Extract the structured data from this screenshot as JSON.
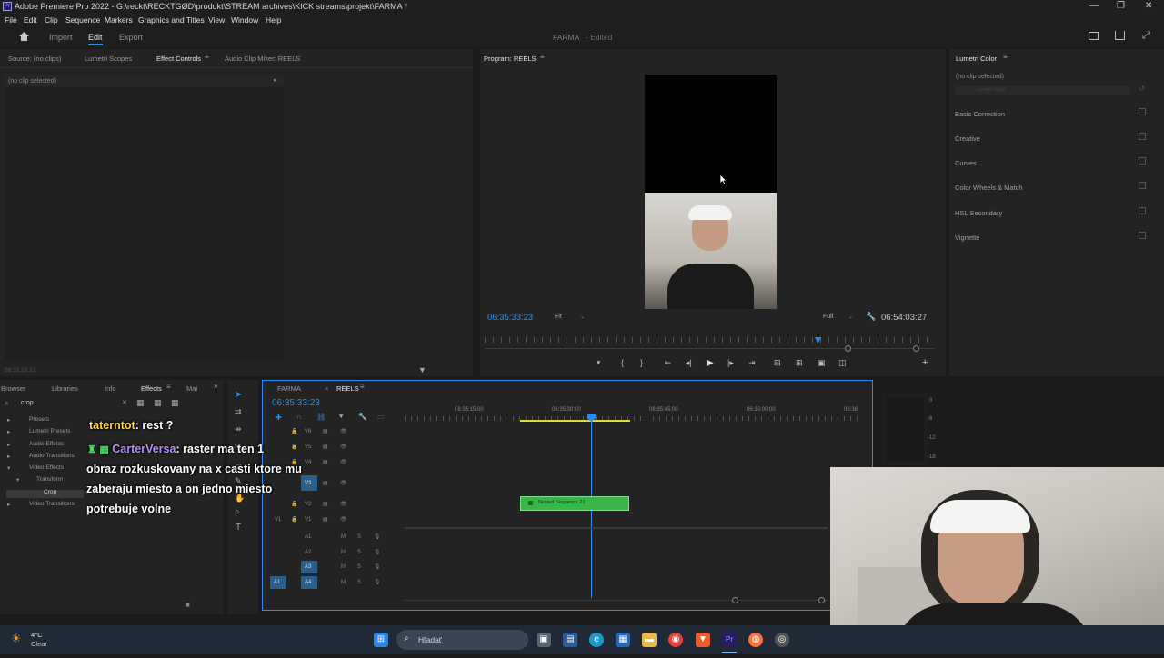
{
  "window": {
    "title": "Adobe Premiere Pro 2022 - G:\\reckt\\RECKTGØD\\produkt\\STREAM archives\\KICK streams\\projekt\\FARMA *",
    "logo": "Pr"
  },
  "menu": [
    "File",
    "Edit",
    "Clip",
    "Sequence",
    "Markers",
    "Graphics and Titles",
    "View",
    "Window",
    "Help"
  ],
  "workspace": {
    "import": "Import",
    "edit": "Edit",
    "export": "Export",
    "project_title": "FARMA",
    "project_status": "- Edited"
  },
  "source_panel": {
    "tabs": [
      "Source: (no clips)",
      "Lumetri Scopes",
      "Effect Controls",
      "Audio Clip Mixer: REELS"
    ],
    "active_tab": "Effect Controls",
    "no_clip": "(no clip selected)",
    "timecode": "06:35:33:23"
  },
  "program": {
    "tab": "Program: REELS",
    "timecode": "06:35:33:23",
    "fit": "Fit",
    "quality": "Full",
    "duration": "06:54:03:27"
  },
  "lumetri": {
    "tab": "Lumetri Color",
    "no_clip": "(no clip selected)",
    "dropdown": "Lumetri Color",
    "sections": [
      "Basic Correction",
      "Creative",
      "Curves",
      "Color Wheels & Match",
      "HSL Secondary",
      "Vignette"
    ]
  },
  "effects_panel": {
    "tabs": [
      "Browser",
      "Libraries",
      "Info",
      "Effects",
      "Mai"
    ],
    "active_tab": "Effects",
    "search_value": "crop",
    "tree": [
      "Presets",
      "Lumetri Presets",
      "Audio Effects",
      "Audio Transitions",
      "Video Effects",
      "Transform",
      "Crop",
      "Video Transitions"
    ]
  },
  "timeline": {
    "tabs": [
      "FARMA",
      "REELS"
    ],
    "active_tab": "REELS",
    "timecode": "06:35:33:23",
    "ruler": [
      "06:35:15:00",
      "06:35:30:00",
      "06:35:45:00",
      "06:36:00:00",
      "06:36"
    ],
    "video_tracks": [
      "V6",
      "V5",
      "V4",
      "V3",
      "V2",
      "V1"
    ],
    "audio_tracks": [
      "A1",
      "A2",
      "A3",
      "A4"
    ],
    "clip_name": "Nested Sequence 21",
    "track_letters": [
      "M",
      "S"
    ],
    "meter_labels": [
      "0",
      "-6",
      "-12",
      "-18"
    ]
  },
  "chat": {
    "line1_user": "taterntot",
    "line1_msg": ": rest ?",
    "line2_user": "CarterVersa",
    "line2_msg": ": raster ma ten 1",
    "line3": "obraz rozkuskovany na x casti ktore mu",
    "line4": "zaberaju miesto a on jedno miesto",
    "line5": "potrebuje volne"
  },
  "taskbar": {
    "weather_temp": "4°C",
    "weather_desc": "Clear",
    "search_placeholder": "Hľadať"
  },
  "colors": {
    "accent_blue": "#2d8ceb",
    "clip_green": "#39b54a",
    "chat_user1": "#ffd54a",
    "chat_user2": "#b48cff"
  }
}
